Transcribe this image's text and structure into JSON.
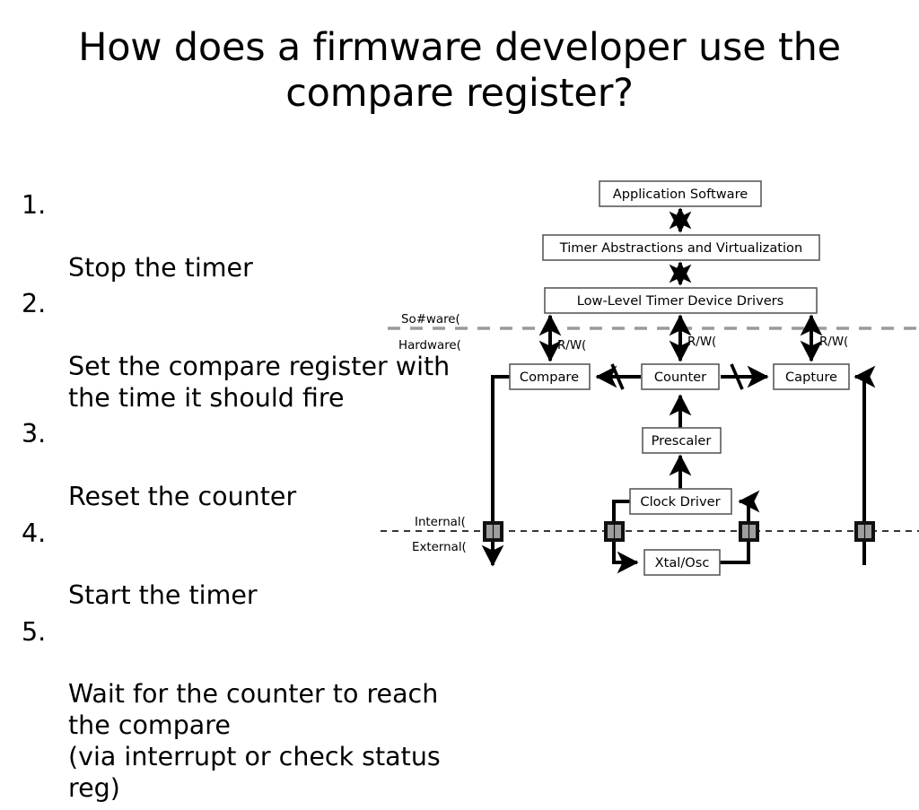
{
  "slide": {
    "title": "How does a firmware developer use the\ncompare register?"
  },
  "steps": [
    {
      "num": "1.",
      "text": "Stop the timer"
    },
    {
      "num": "2.",
      "text": "Set the compare register with\nthe time it should fire"
    },
    {
      "num": "3.",
      "text": "Reset the counter"
    },
    {
      "num": "4.",
      "text": "Start the timer"
    },
    {
      "num": "5.",
      "text": "Wait for the counter to reach\nthe compare\n(via interrupt or check status\nreg)"
    }
  ],
  "diagram": {
    "boxes": {
      "application_software": "Application Software",
      "timer_abstractions": "Timer Abstractions and Virtualization",
      "low_level_drivers": "Low-Level Timer Device Drivers",
      "compare": "Compare",
      "counter": "Counter",
      "capture": "Capture",
      "prescaler": "Prescaler",
      "clock_driver": "Clock Driver",
      "xtal_osc": "Xtal/Osc"
    },
    "labels": {
      "software": "So#ware(",
      "hardware": "Hardware(",
      "internal": "Internal(",
      "external": "External(",
      "rw_compare": "R/W(",
      "rw_counter": "R/W(",
      "rw_capture": "R/W("
    },
    "colors": {
      "box_stroke": "#5a5a5a",
      "wire": "#000000",
      "sw_hw_divider": "#9a9a9a",
      "int_ext_divider": "#1a1a1a",
      "pin_fill": "#9e9e9e",
      "pin_border": "#111111",
      "background": "#ffffff"
    }
  }
}
